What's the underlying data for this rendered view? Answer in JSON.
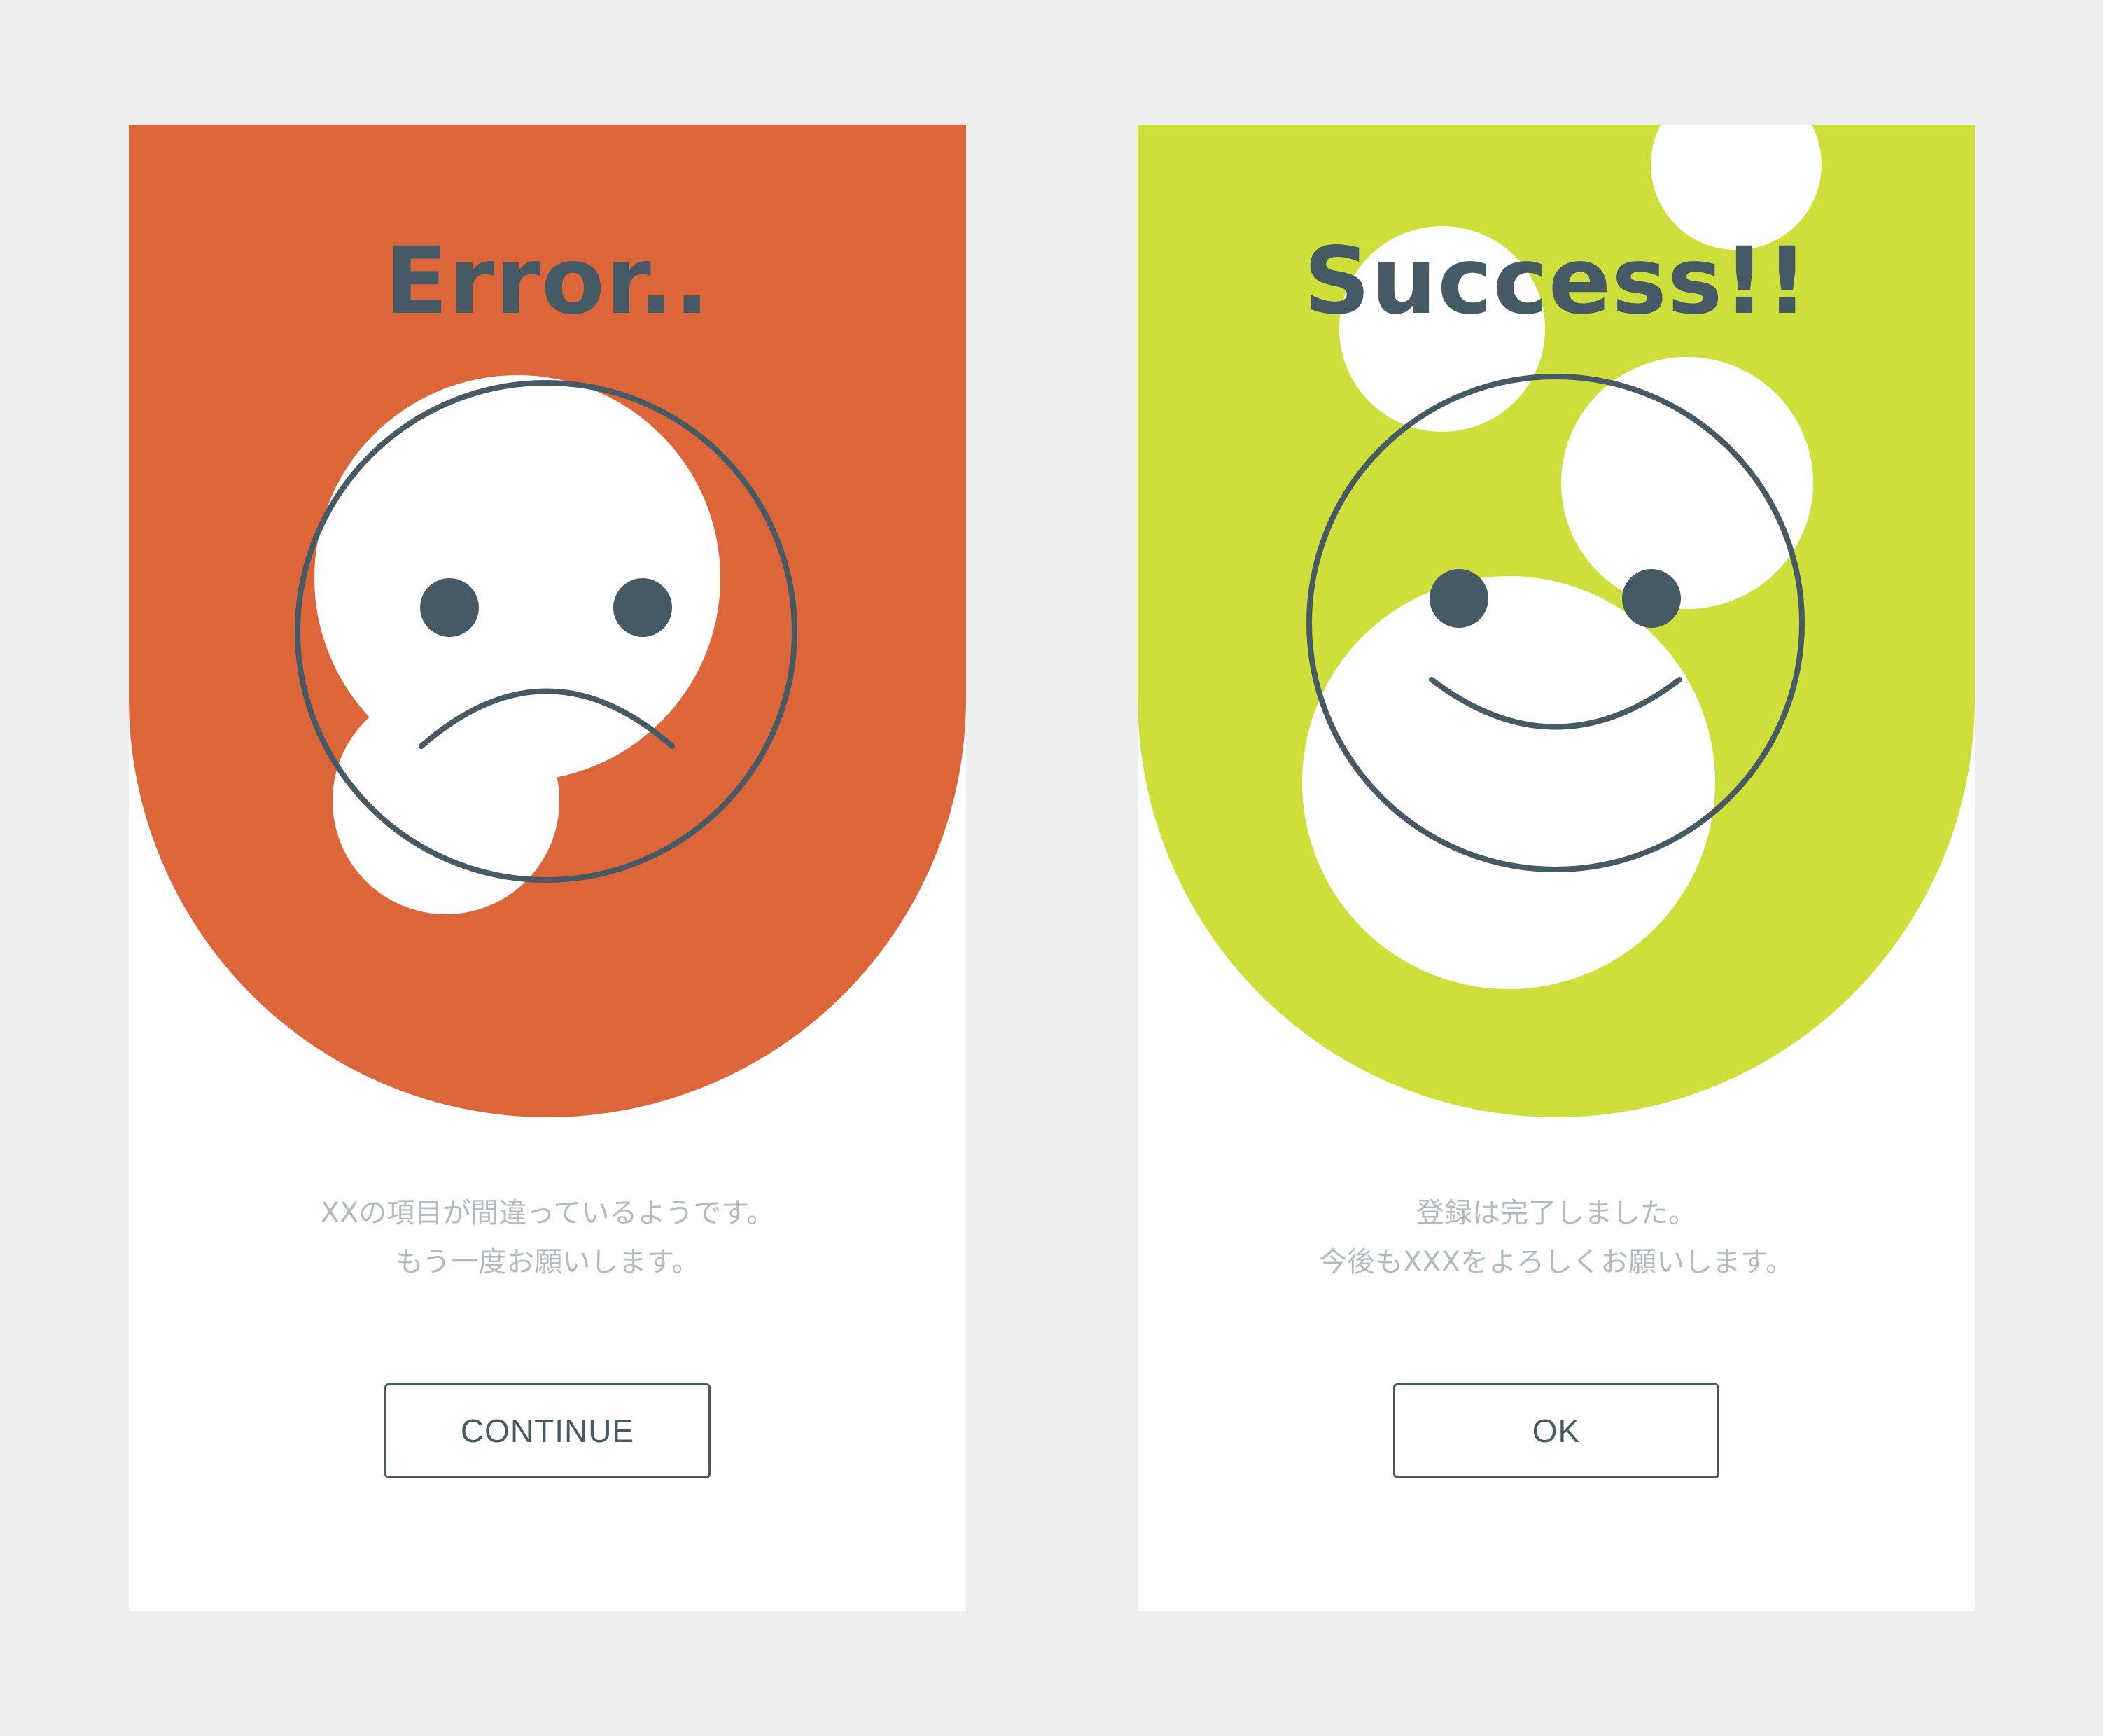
{
  "colors": {
    "background": "#eeeeee",
    "card": "#ffffff",
    "error_accent": "#dc6539",
    "success_accent": "#cedf3b",
    "ink": "#455a64",
    "message_text": "#b0bcc2"
  },
  "error_card": {
    "title": "Error..",
    "face_icon": "sad-face-icon",
    "message_line1": "XXの項目が間違っているようです。",
    "message_line2": "もう一度お願いします。",
    "button_label": "CONTINUE"
  },
  "success_card": {
    "title": "Success!!",
    "face_icon": "smiley-face-icon",
    "message_line1": "登録は完了しました。",
    "message_line2": "今後もXXXをよろしくお願いします。",
    "button_label": "OK"
  }
}
